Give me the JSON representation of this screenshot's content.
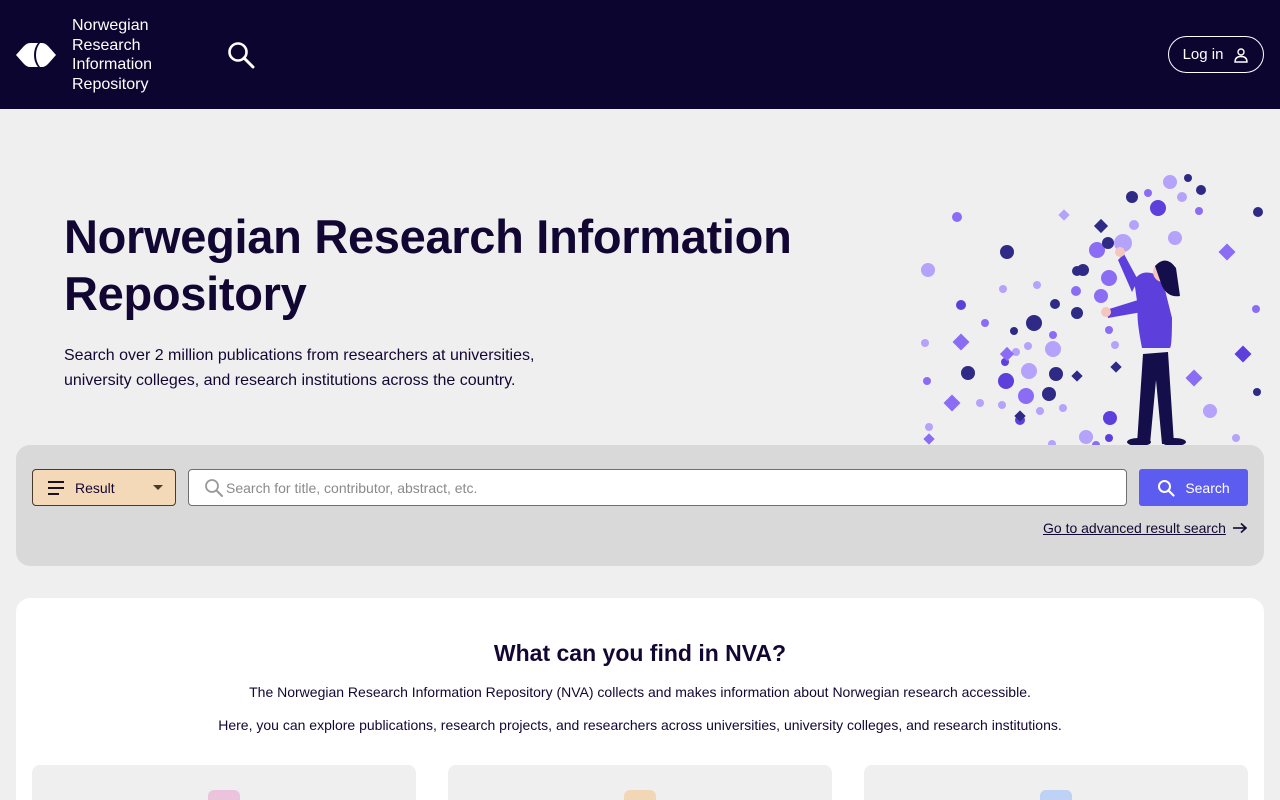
{
  "header": {
    "logo_line1": "Norwegian",
    "logo_line2": "Research",
    "logo_line3": "Information",
    "logo_line4": "Repository",
    "login_label": "Log in"
  },
  "hero": {
    "title": "Norwegian Research Information Repository",
    "subtitle": "Search over 2 million publications from researchers at universities, university colleges, and research institutions across the country."
  },
  "search": {
    "type_selected": "Result",
    "placeholder": "Search for title, contributor, abstract, etc.",
    "button_label": "Search",
    "advanced_link": "Go to advanced result search"
  },
  "info": {
    "title": "What can you find in NVA?",
    "p1": "The Norwegian Research Information Repository (NVA) collects and makes information about Norwegian research accessible.",
    "p2": "Here, you can explore publications, research projects, and researchers across universities, university colleges, and research institutions."
  },
  "colors": {
    "header_bg": "#0c0530",
    "accent": "#5c5cf0",
    "result_select_bg": "#f4d9b8",
    "card1_icon": "#ecc3dc",
    "card2_icon": "#f2d7b6",
    "card3_icon": "#bdd2f5"
  }
}
